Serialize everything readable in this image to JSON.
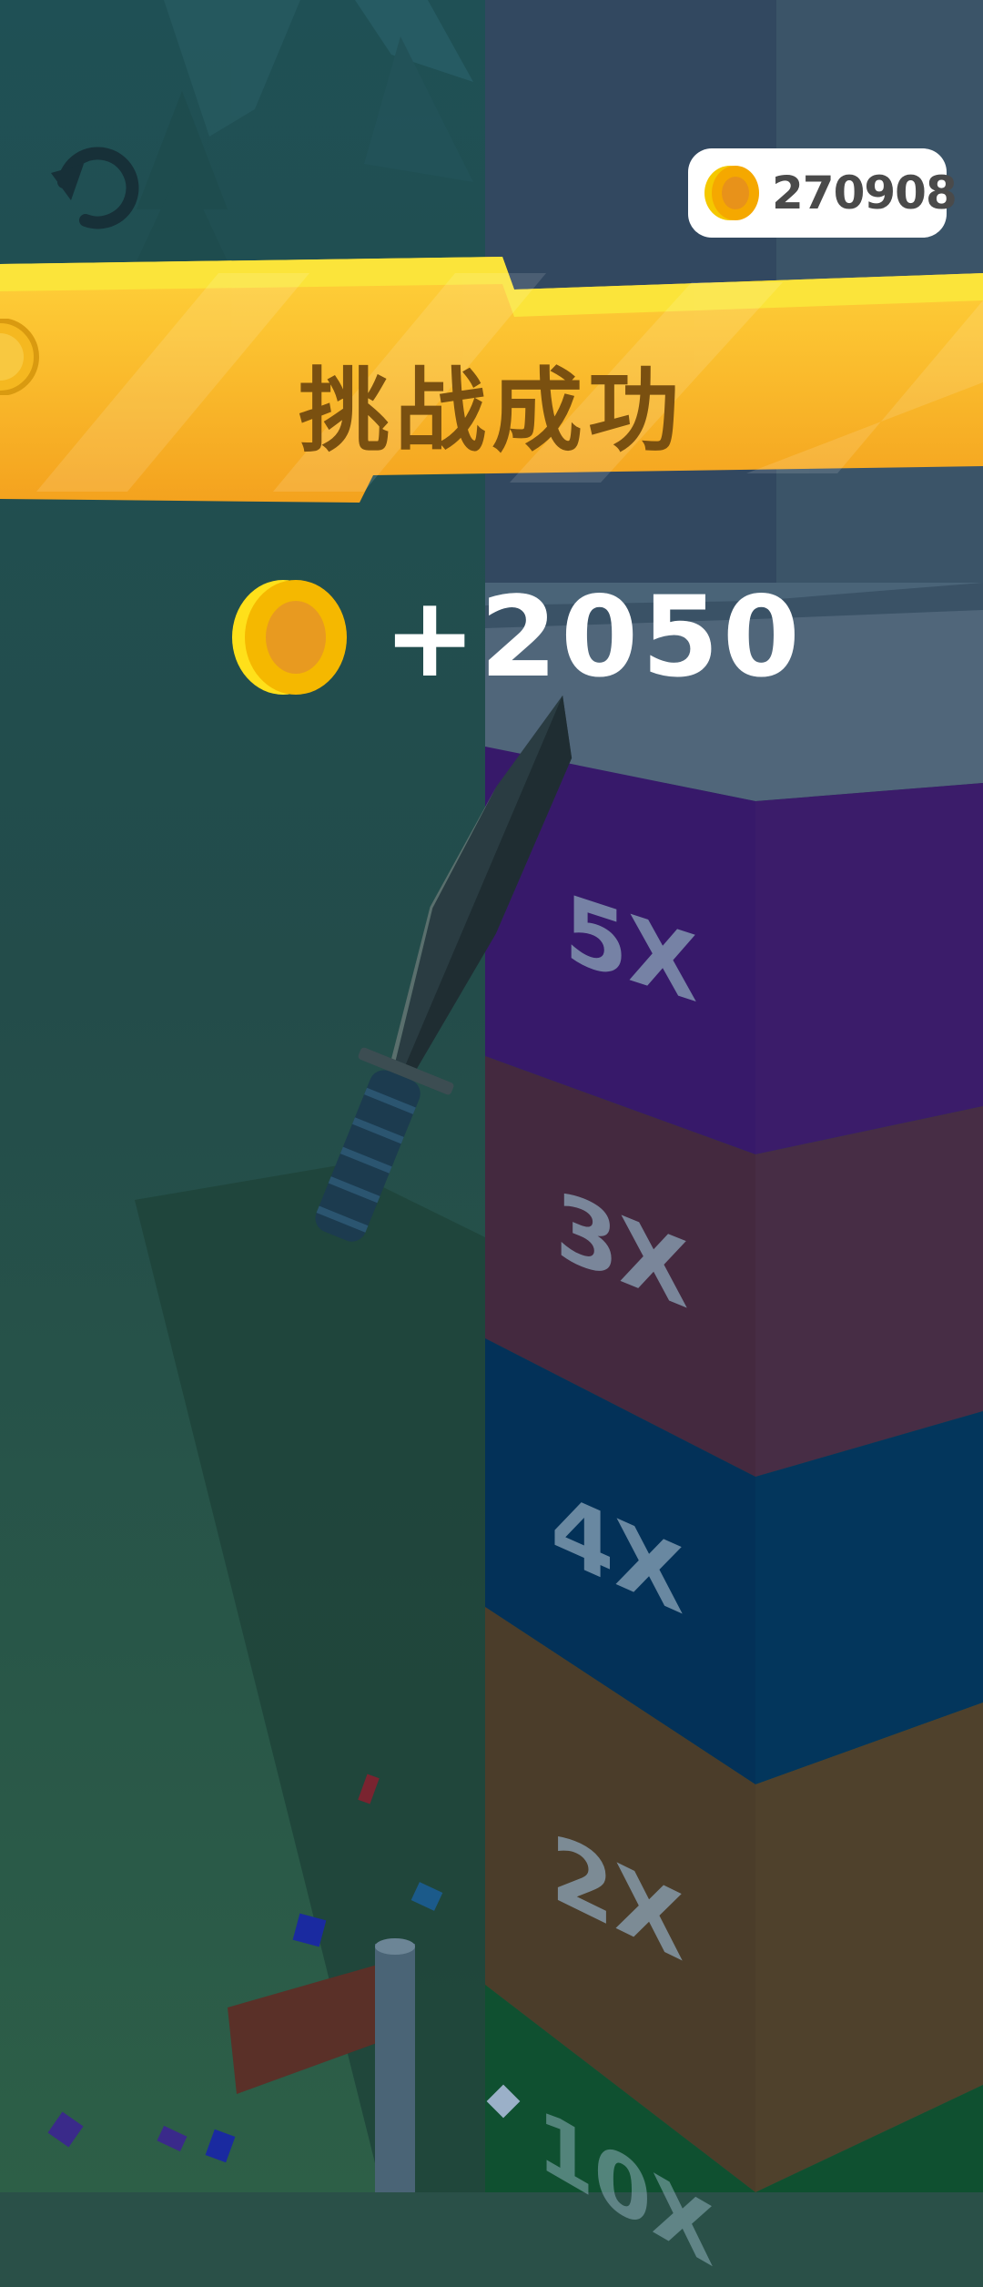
{
  "hud": {
    "coin_total": "270908",
    "restart_icon": "restart-icon",
    "coin_icon": "coin-icon"
  },
  "banner": {
    "title": "挑战成功"
  },
  "reward": {
    "amount": "+2050"
  },
  "tower": {
    "multipliers": [
      {
        "label": "5X",
        "color": "#3b1c6a"
      },
      {
        "label": "3X",
        "color": "#472d45"
      },
      {
        "label": "4X",
        "color": "#03365c"
      },
      {
        "label": "2X",
        "color": "#4f412c"
      },
      {
        "label": "10X",
        "color": "#0f5030"
      }
    ]
  },
  "colors": {
    "banner": "#f8ad2a",
    "banner_highlight": "#f9d83c",
    "coin": "#f5b700",
    "background": "#2a5048"
  }
}
